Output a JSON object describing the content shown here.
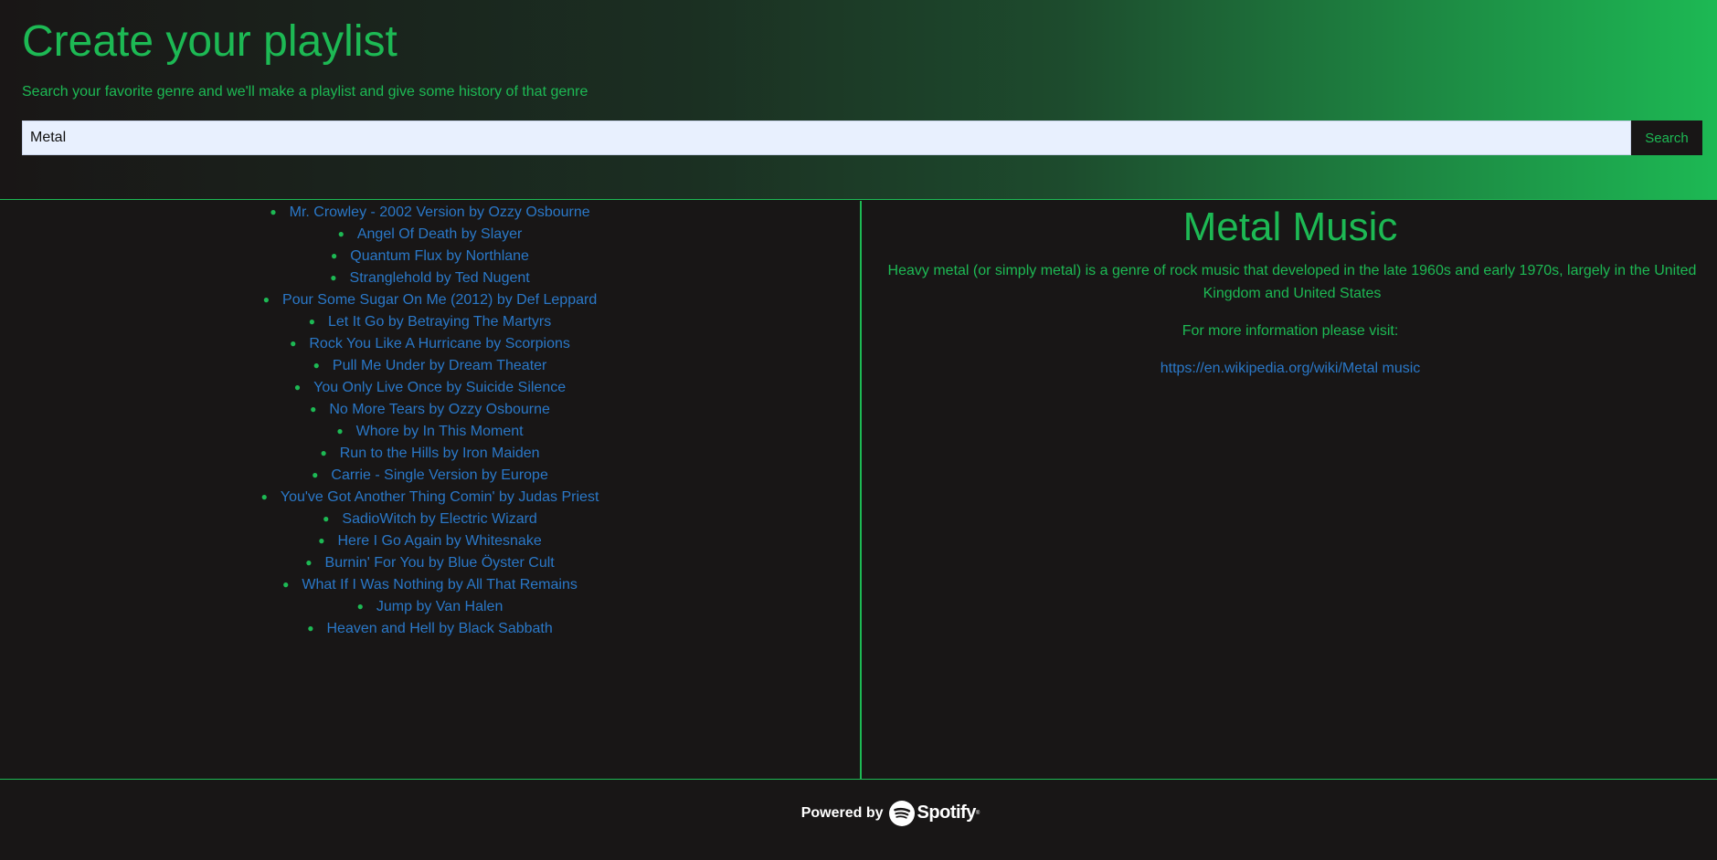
{
  "header": {
    "title": "Create your playlist",
    "subtitle": "Search your favorite genre and we'll make a playlist and give some history of that genre",
    "search": {
      "value": "Metal",
      "button_label": "Search"
    }
  },
  "playlist": {
    "tracks": [
      "Mr. Crowley - 2002 Version by Ozzy Osbourne",
      "Angel Of Death by Slayer",
      "Quantum Flux by Northlane",
      "Stranglehold by Ted Nugent",
      "Pour Some Sugar On Me (2012) by Def Leppard",
      "Let It Go by Betraying The Martyrs",
      "Rock You Like A Hurricane by Scorpions",
      "Pull Me Under by Dream Theater",
      "You Only Live Once by Suicide Silence",
      "No More Tears by Ozzy Osbourne",
      "Whore by In This Moment",
      "Run to the Hills by Iron Maiden",
      "Carrie - Single Version by Europe",
      "You've Got Another Thing Comin' by Judas Priest",
      "SadioWitch by Electric Wizard",
      "Here I Go Again by Whitesnake",
      "Burnin' For You by Blue Öyster Cult",
      "What If I Was Nothing by All That Remains",
      "Jump by Van Halen",
      "Heaven and Hell by Black Sabbath"
    ]
  },
  "info": {
    "title": "Metal Music",
    "description": "Heavy metal (or simply metal) is a genre of rock music that developed in the late 1960s and early 1970s, largely in the United Kingdom and United States",
    "more_info_label": "For more information please visit:",
    "link_text": "https://en.wikipedia.org/wiki/Metal music"
  },
  "footer": {
    "powered_by": "Powered by",
    "brand": "Spotify",
    "trademark": "®",
    "logo_icon": "spotify-icon"
  },
  "colors": {
    "accent": "#1db954",
    "background": "#181616",
    "link": "#2a78c8"
  }
}
